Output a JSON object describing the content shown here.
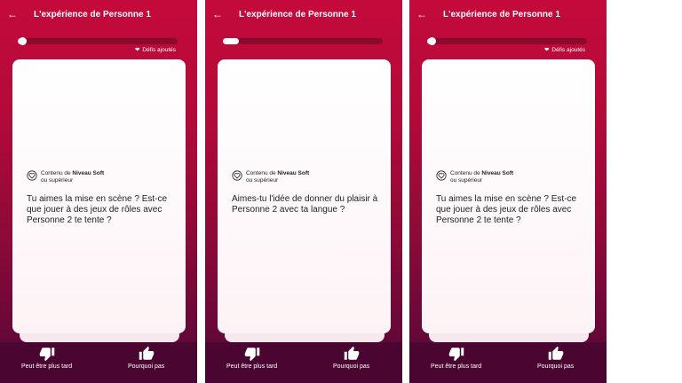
{
  "screens": [
    {
      "title": "L'expérience de Personne 1",
      "progress": 0.03,
      "added_label": "Défis ajoutés",
      "level_prefix": "Contenu de ",
      "level_name": "Niveau Soft",
      "level_suffix": "ou supérieur",
      "question": "Tu aimes la mise en scène ? Est-ce que jouer à des jeux de rôles avec Personne 2 te tente ?",
      "left_action": "Peut être plus tard",
      "right_action": "Pourquoi pas"
    },
    {
      "title": "L'expérience de Personne 1",
      "progress": 0.1,
      "added_label": "",
      "level_prefix": "Contenu de ",
      "level_name": "Niveau Soft",
      "level_suffix": "ou supérieur",
      "question": "Aimes-tu l'idée de donner du plaisir à Personne 2 avec ta langue ?",
      "left_action": "Peut être plus tard",
      "right_action": "Pourquoi pas"
    },
    {
      "title": "L'expérience de Personne 1",
      "progress": 0.03,
      "added_label": "Défis ajoutés",
      "level_prefix": "Contenu de ",
      "level_name": "Niveau Soft",
      "level_suffix": "ou supérieur",
      "question": "Tu aimes la mise en scène ? Est-ce que jouer à des jeux de rôles avec Personne 2 te tente ?",
      "left_action": "Peut être plus tard",
      "right_action": "Pourquoi pas"
    }
  ],
  "icons": {
    "back": "arrow-left-icon",
    "heart": "heart-icon",
    "level": "heart-badge-icon",
    "thumbs_down": "thumbs-down-icon",
    "thumbs_up": "thumbs-up-icon"
  },
  "colors": {
    "header_red": "#c40a3b",
    "bottom_bar": "#4a0530",
    "progress_track": "#8a0a2e",
    "card": "#ffffff"
  }
}
